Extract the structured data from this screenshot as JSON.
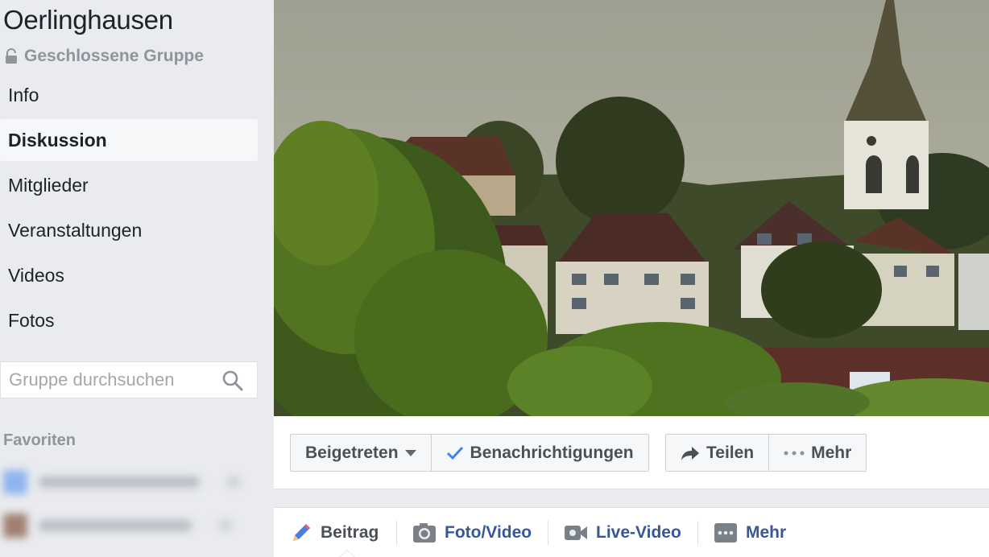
{
  "group": {
    "title": "Oerlinghausen",
    "privacy": "Geschlossene Gruppe"
  },
  "nav": {
    "items": [
      {
        "label": "Info",
        "active": false
      },
      {
        "label": "Diskussion",
        "active": true
      },
      {
        "label": "Mitglieder",
        "active": false
      },
      {
        "label": "Veranstaltungen",
        "active": false
      },
      {
        "label": "Videos",
        "active": false
      },
      {
        "label": "Fotos",
        "active": false
      }
    ]
  },
  "search": {
    "placeholder": "Gruppe durchsuchen",
    "value": ""
  },
  "favorites": {
    "label": "Favoriten"
  },
  "actions": {
    "joined": "Beigetreten",
    "notifications": "Benachrichtigungen",
    "share": "Teilen",
    "more": "Mehr"
  },
  "composer": {
    "tabs": [
      {
        "label": "Beitrag",
        "icon": "pencil-icon"
      },
      {
        "label": "Foto/Video",
        "icon": "camera-icon"
      },
      {
        "label": "Live-Video",
        "icon": "video-camera-icon"
      },
      {
        "label": "Mehr",
        "icon": "more-dots-icon"
      }
    ]
  },
  "colors": {
    "link": "#365899",
    "accent_check": "#4080ff",
    "background": "#e9ebee"
  }
}
